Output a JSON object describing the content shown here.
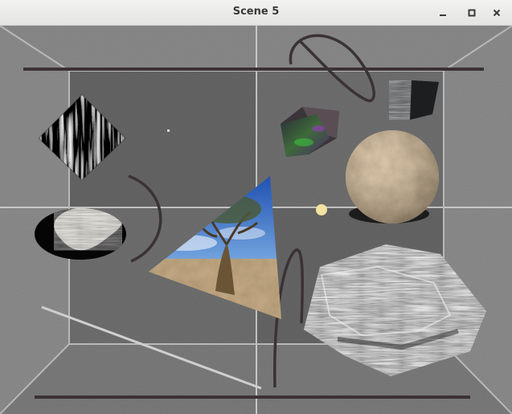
{
  "window": {
    "title": "Scene 5",
    "controls": {
      "minimize_icon": "minimize-icon",
      "maximize_icon": "maximize-icon",
      "close_icon": "close-icon"
    }
  },
  "scene": {
    "walls_color": "#7f7f7f",
    "back_wall_color": "#6f6f6f",
    "grid_line_color": "#c8c8c8",
    "bar_color": "#3a3234",
    "objects": [
      "textured-diamond",
      "textured-ellipse",
      "photo-triangle",
      "textured-cube",
      "small-textured-cube",
      "textured-sphere",
      "textured-hexagon",
      "yellow-point-light"
    ]
  }
}
